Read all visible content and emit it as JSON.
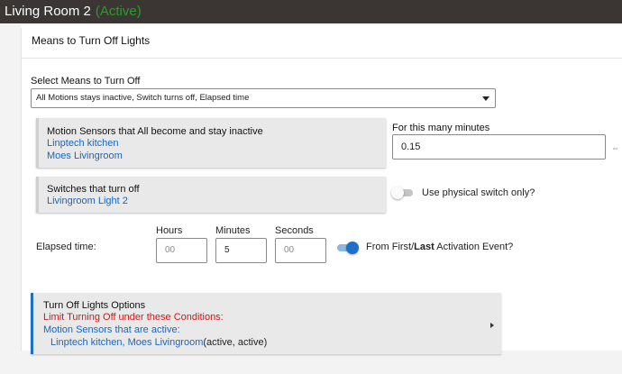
{
  "window": {
    "title": "Living Room 2",
    "status": "(Active)"
  },
  "section": {
    "title": "Means to Turn Off Lights"
  },
  "means_select": {
    "label": "Select Means to Turn Off",
    "value": "All Motions stays inactive, Switch turns off, Elapsed time"
  },
  "motion_card": {
    "title": "Motion Sensors that All become and stay inactive",
    "devices": [
      "Linptech kitchen",
      "Moes Livingroom"
    ]
  },
  "minutes": {
    "label": "For this many minutes",
    "value": "0.15",
    "side_icon": "expand-icon"
  },
  "switch_card": {
    "title": "Switches that turn off",
    "devices": [
      "Livingroom Light 2"
    ]
  },
  "physical_switch": {
    "label": "Use physical switch only?",
    "on": false
  },
  "elapsed": {
    "label": "Elapsed time:",
    "hours_label": "Hours",
    "hours_placeholder": "00",
    "minutes_label": "Minutes",
    "minutes_value": "5",
    "seconds_label": "Seconds",
    "seconds_placeholder": "00",
    "first_last_prefix": "From First/",
    "first_last_bold": "Last",
    "first_last_suffix": " Activation Event?",
    "first_last_on": true
  },
  "options": {
    "title": "Turn Off Lights Options",
    "limit": "Limit Turning Off under these Conditions:",
    "sensors_heading": "Motion Sensors that are active:",
    "sensors": "Linptech kitchen, Moes Livingroom",
    "sensors_state": "(active, active)"
  },
  "colors": {
    "accent": "#1e6fc7",
    "active_status": "#2e9a2e",
    "warning": "#d01818",
    "titlebar": "#3b3633"
  }
}
